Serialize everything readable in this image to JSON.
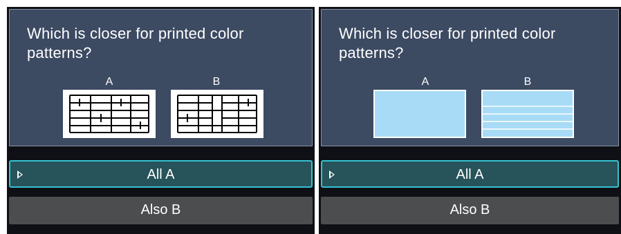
{
  "screens": [
    {
      "prompt": "Which is closer for printed color patterns?",
      "option_a_label": "A",
      "option_b_label": "B",
      "pattern_a_icon": "ruled-grid-pattern-icon",
      "pattern_b_icon": "ruled-grid-pattern-variant-icon",
      "menu": {
        "selected_label": "All A",
        "other_label": "Also B"
      }
    },
    {
      "prompt": "Which is closer for printed color patterns?",
      "option_a_label": "A",
      "option_b_label": "B",
      "pattern_a_icon": "solid-blue-pattern-icon",
      "pattern_b_icon": "striped-blue-pattern-icon",
      "menu": {
        "selected_label": "All A",
        "other_label": "Also B"
      }
    }
  ],
  "colors": {
    "panel_bg": "#3c4a62",
    "selected_bg": "#27535a",
    "selected_border": "#35c3d2",
    "normal_bg": "#4b4d4f",
    "pattern_blue": "#a8dcf6"
  }
}
